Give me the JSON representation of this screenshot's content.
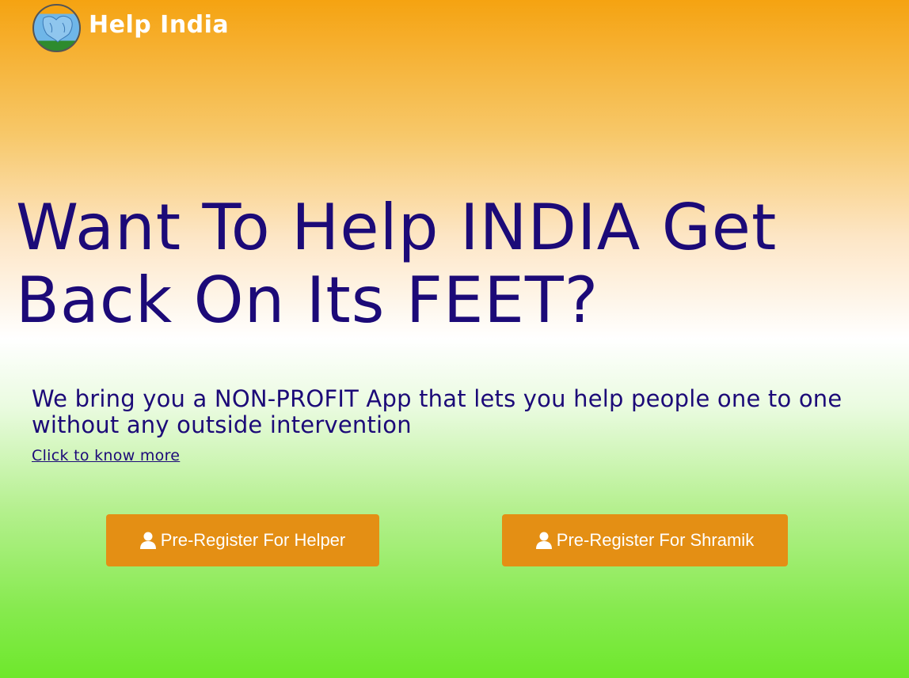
{
  "header": {
    "brand": "Help India",
    "logo_icon": "india-map-logo-icon"
  },
  "hero": {
    "title": "Want To Help INDIA Get Back On Its FEET?",
    "subtitle": "We bring you a NON-PROFIT App that lets you help people one to one without any outside intervention",
    "link_label": "Click to know more"
  },
  "actions": {
    "helper_label": "Pre-Register For Helper",
    "shramik_label": "Pre-Register For Shramik",
    "icon": "user-icon"
  },
  "colors": {
    "saffron": "#f5a311",
    "green": "#6ee82c",
    "text": "#1c0a78",
    "button": "#e48f14"
  }
}
